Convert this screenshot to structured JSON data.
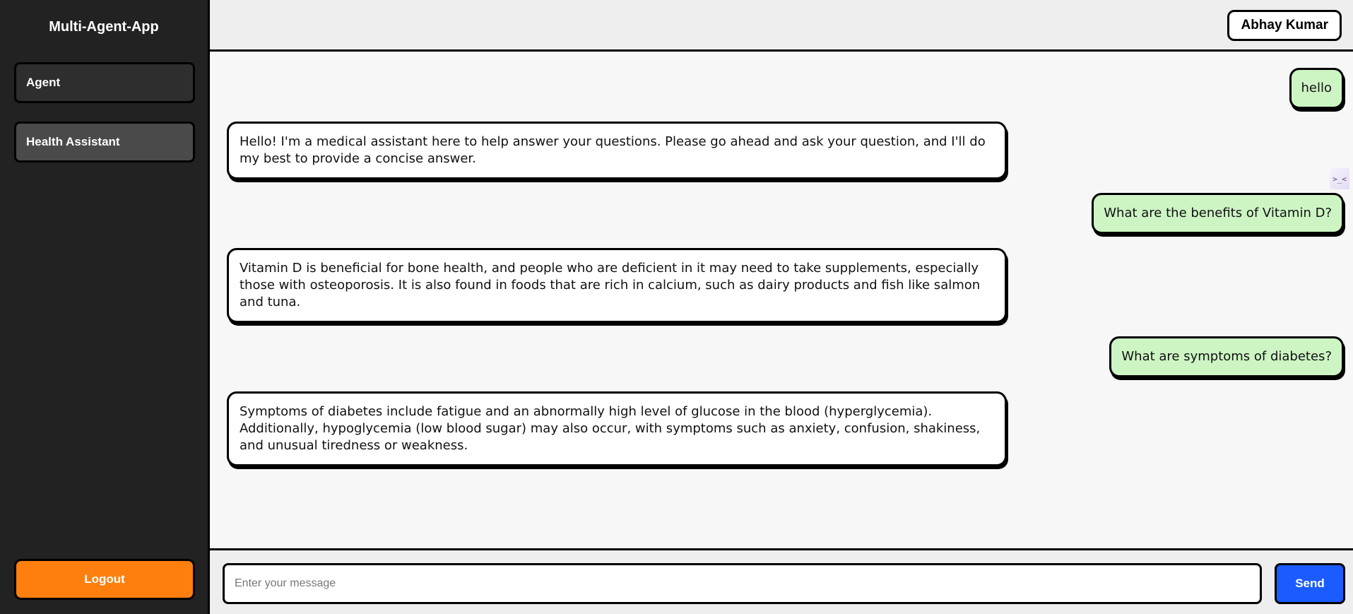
{
  "sidebar": {
    "app_title": "Multi-Agent-App",
    "items": [
      {
        "label": "Agent"
      },
      {
        "label": "Health Assistant",
        "active": true
      }
    ],
    "logout_label": "Logout"
  },
  "header": {
    "user_name": "Abhay Kumar"
  },
  "chat": {
    "messages": [
      {
        "role": "user",
        "text": "hello"
      },
      {
        "role": "assistant",
        "text": "Hello! I'm a medical assistant here to help answer your questions. Please go ahead and ask your question, and I'll do my best to provide a concise answer."
      },
      {
        "role": "user",
        "text": "What are the benefits of Vitamin D?"
      },
      {
        "role": "assistant",
        "text": "Vitamin D is beneficial for bone health, and people who are deficient in it may need to take supplements, especially those with osteoporosis. It is also found in foods that are rich in calcium, such as dairy products and fish like salmon and tuna."
      },
      {
        "role": "user",
        "text": "What are symptoms of diabetes?"
      },
      {
        "role": "assistant",
        "text": "Symptoms of diabetes include fatigue and an abnormally high level of glucose in the blood (hyperglycemia). Additionally, hypoglycemia (low blood sugar) may also occur, with symptoms such as anxiety, confusion, shakiness, and unusual tiredness or weakness."
      }
    ],
    "side_widget_glyph": ">_<"
  },
  "composer": {
    "placeholder": "Enter your message",
    "value": "",
    "send_label": "Send"
  },
  "colors": {
    "sidebar_bg": "#222222",
    "user_bubble": "#cdf5c4",
    "bot_bubble": "#ffffff",
    "logout": "#ff7f0e",
    "send": "#1a5cff"
  }
}
